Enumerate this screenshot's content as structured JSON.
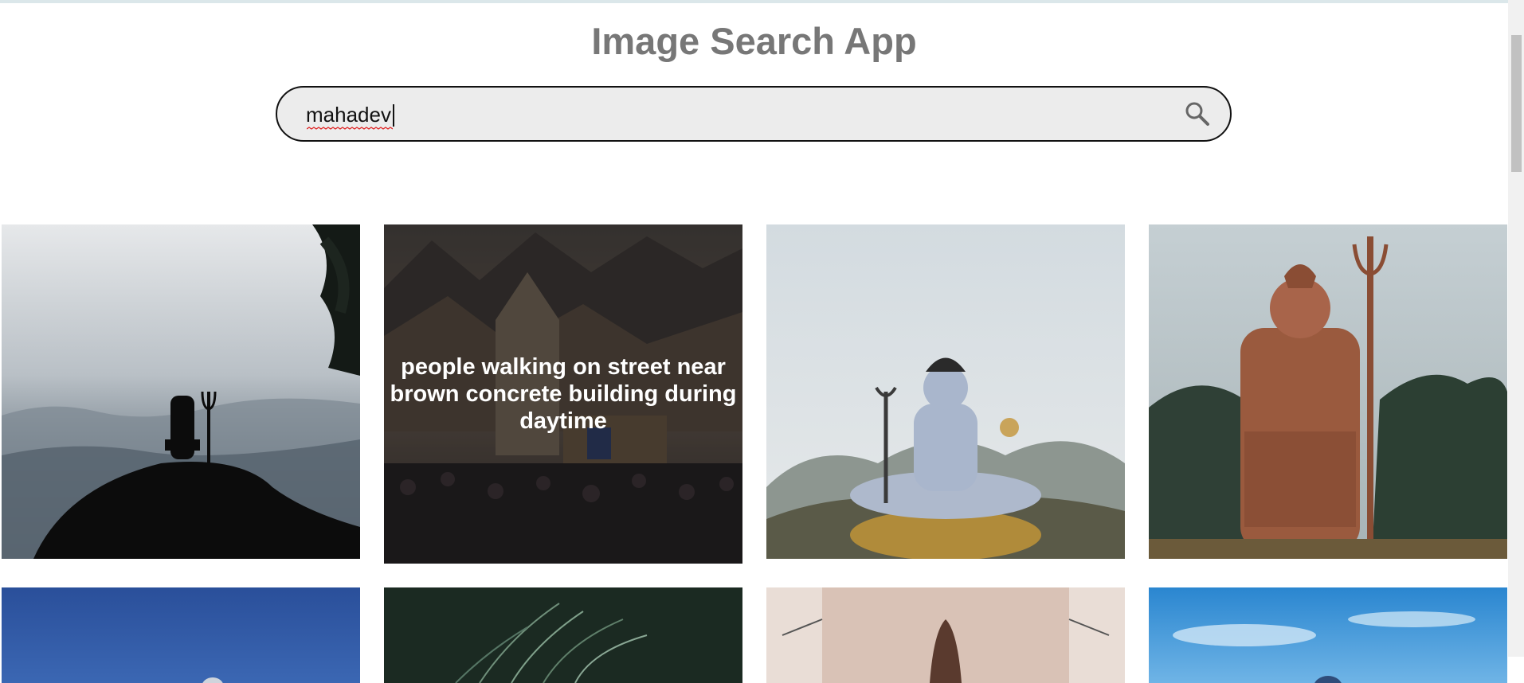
{
  "app": {
    "title": "Image Search App"
  },
  "search": {
    "value": "mahadev",
    "icon": "search-icon"
  },
  "results": [
    {
      "alt": "",
      "theme": "misty-silhouette"
    },
    {
      "alt": "people walking on street near brown concrete building during daytime",
      "theme": "temple-crowd",
      "hovered": true
    },
    {
      "alt": "",
      "theme": "blue-statue"
    },
    {
      "alt": "",
      "theme": "copper-statue"
    },
    {
      "alt": "",
      "theme": "blue-sky-statue"
    },
    {
      "alt": "",
      "theme": "peacock-feather"
    },
    {
      "alt": "",
      "theme": "mural-wall"
    },
    {
      "alt": "",
      "theme": "sky-clouds"
    }
  ],
  "colors": {
    "title": "#777777",
    "search_bg": "#ececec",
    "search_border": "#111111",
    "overlay": "rgba(0,0,0,0.42)"
  }
}
